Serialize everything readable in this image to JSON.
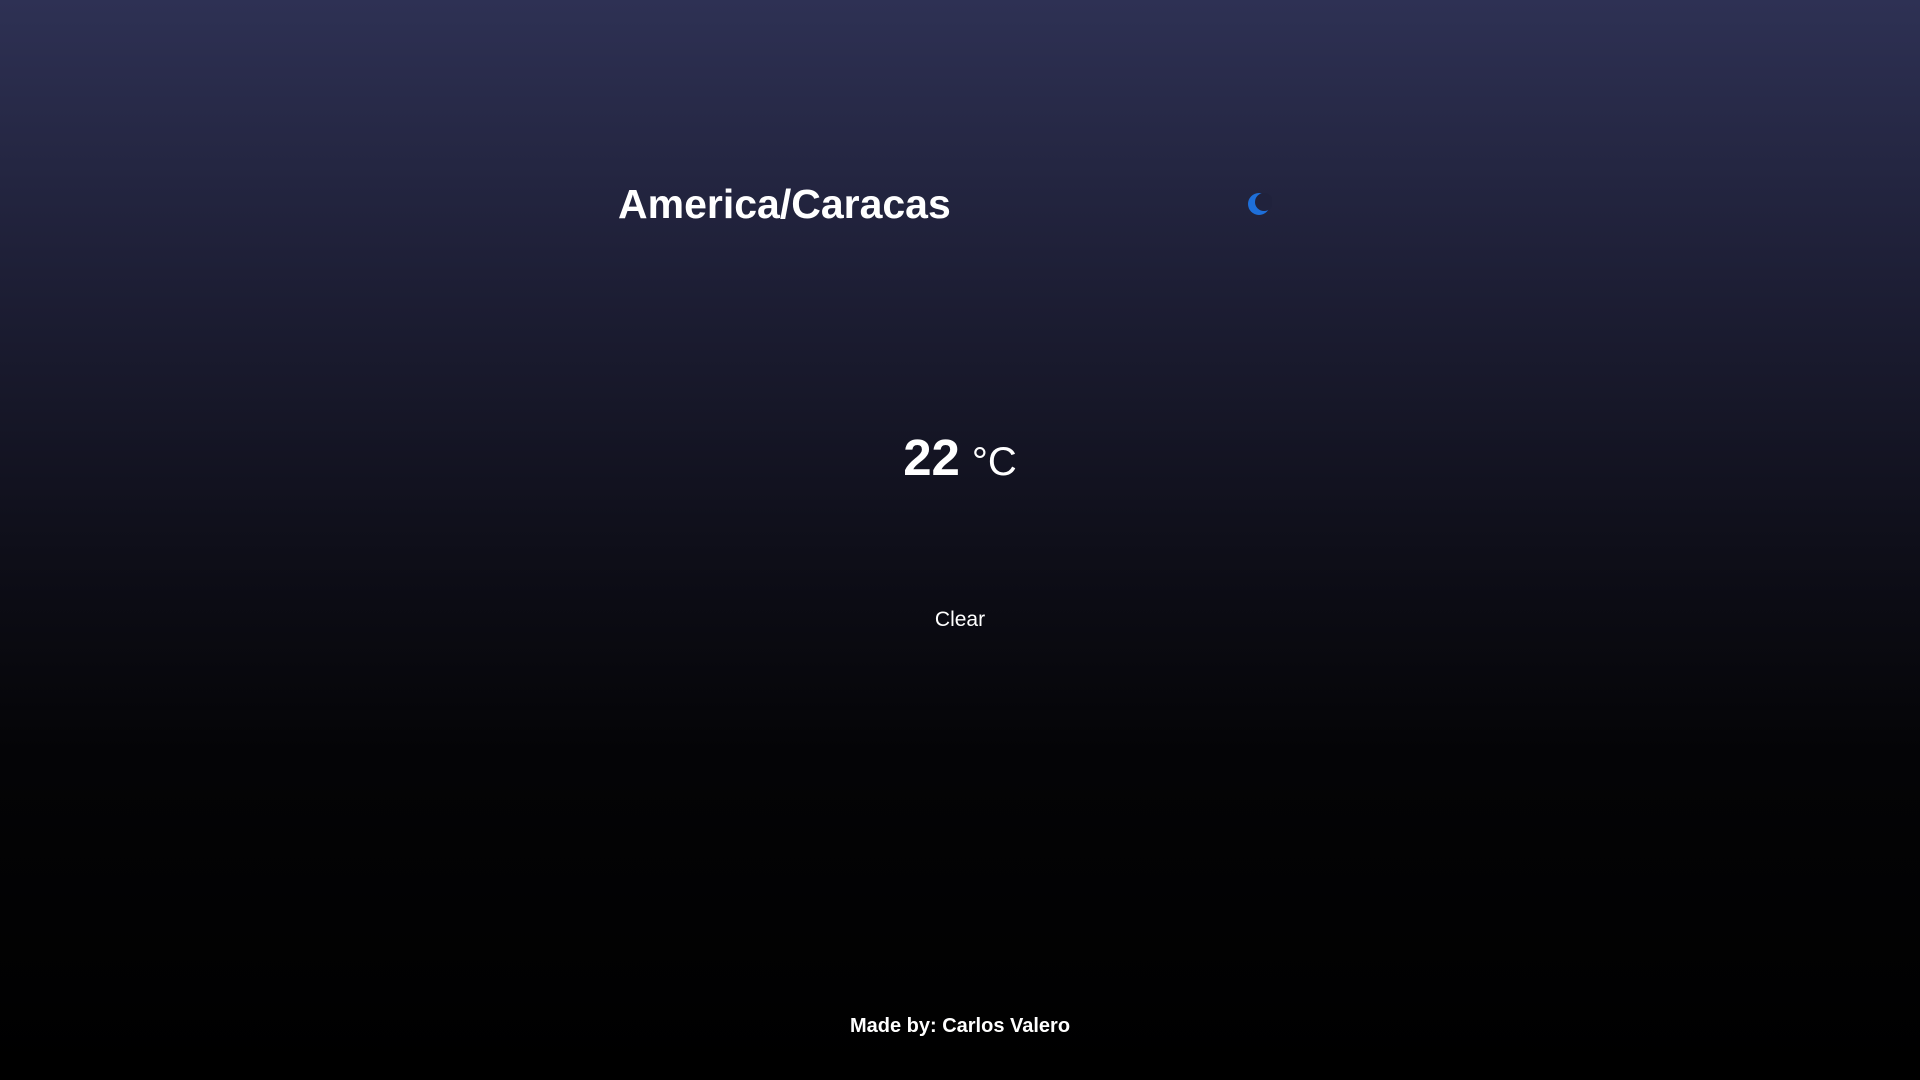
{
  "location": {
    "title": "America/Caracas"
  },
  "weather": {
    "icon": "moon-icon",
    "icon_color": "#1e6fd9",
    "temperature": "22",
    "unit": "°C",
    "condition": "Clear"
  },
  "footer": {
    "credit": "Made by: Carlos Valero"
  },
  "colors": {
    "text": "#ffffff",
    "background_top": "#2e3154",
    "background_bottom": "#000000"
  }
}
